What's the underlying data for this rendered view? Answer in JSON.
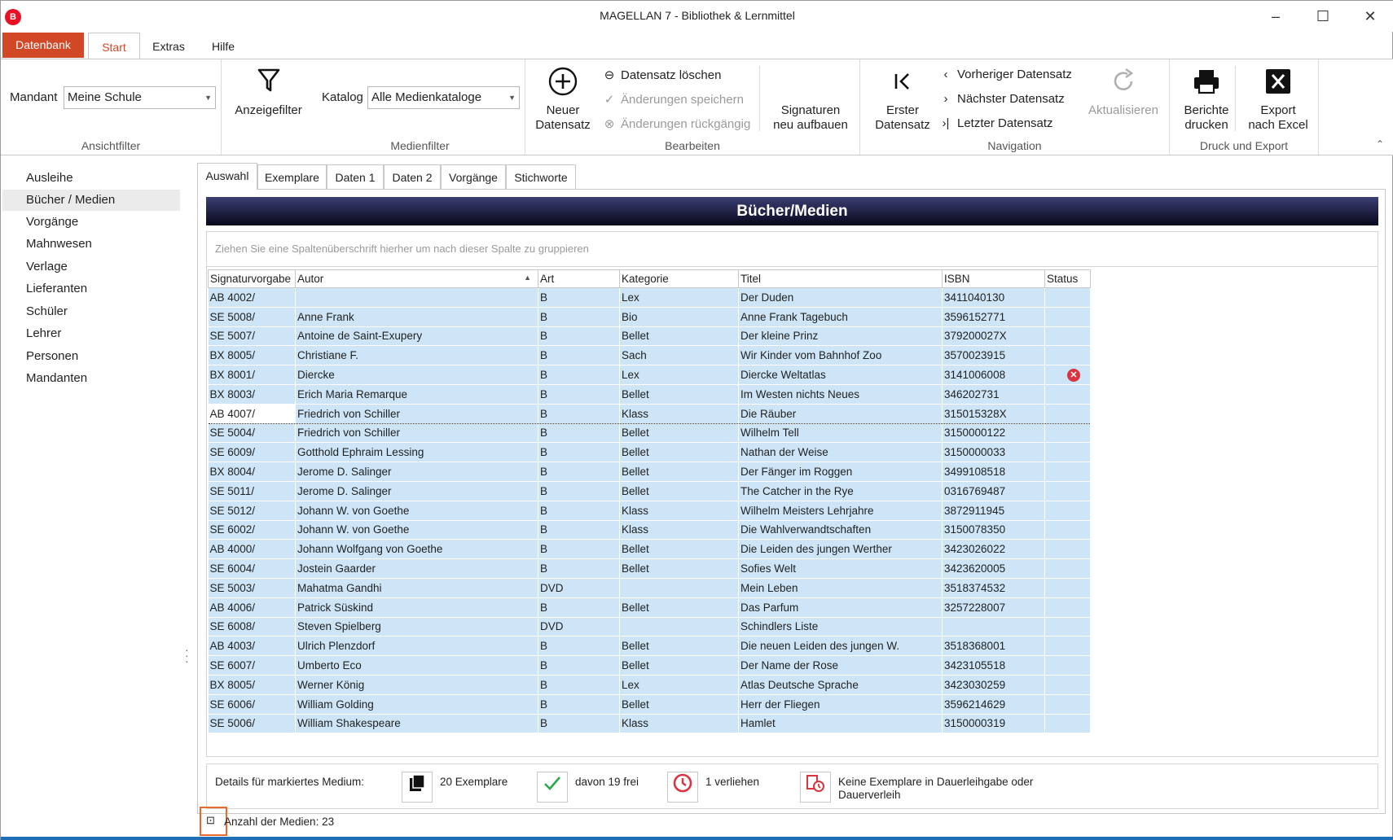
{
  "window": {
    "title": "MAGELLAN 7 - Bibliothek & Lernmittel",
    "badge": "B",
    "minimize": "–",
    "maximize": "☐",
    "close": "✕"
  },
  "ribbon_tabs": {
    "file": "Datenbank",
    "start": "Start",
    "extras": "Extras",
    "help": "Hilfe"
  },
  "ribbon": {
    "view_filter": {
      "mandant_label": "Mandant",
      "mandant_value": "Meine Schule",
      "group_label": "Ansichtfilter"
    },
    "display_filter": {
      "label": "Anzeigefilter"
    },
    "media_filter": {
      "katalog_label": "Katalog",
      "katalog_value": "Alle Medienkataloge",
      "group_label": "Medienfilter"
    },
    "edit": {
      "new_record_line1": "Neuer",
      "new_record_line2": "Datensatz",
      "delete_record": "Datensatz löschen",
      "save_changes": "Änderungen speichern",
      "undo_changes": "Änderungen rückgängig",
      "signatures_line1": "Signaturen",
      "signatures_line2": "neu aufbauen",
      "group_label": "Bearbeiten"
    },
    "navigation": {
      "first_line1": "Erster",
      "first_line2": "Datensatz",
      "previous": "Vorheriger Datensatz",
      "next": "Nächster Datensatz",
      "last": "Letzter Datensatz",
      "refresh": "Aktualisieren",
      "group_label": "Navigation"
    },
    "print_export": {
      "print_line1": "Berichte",
      "print_line2": "drucken",
      "excel_line1": "Export",
      "excel_line2": "nach Excel",
      "group_label": "Druck und Export"
    }
  },
  "sidebar": {
    "items": [
      {
        "label": "Ausleihe"
      },
      {
        "label": "Bücher / Medien"
      },
      {
        "label": "Vorgänge"
      },
      {
        "label": "Mahnwesen"
      },
      {
        "label": "Verlage"
      },
      {
        "label": "Lieferanten"
      },
      {
        "label": "Schüler"
      },
      {
        "label": "Lehrer"
      },
      {
        "label": "Personen"
      },
      {
        "label": "Mandanten"
      }
    ],
    "selected": "Bücher / Medien"
  },
  "content_tabs": [
    "Auswahl",
    "Exemplare",
    "Daten 1",
    "Daten 2",
    "Vorgänge",
    "Stichworte"
  ],
  "grid": {
    "title": "Bücher/Medien",
    "group_hint": "Ziehen Sie eine Spaltenüberschrift hierher um nach dieser Spalte zu gruppieren",
    "columns": [
      "Signaturvorgabe",
      "Autor",
      "Art",
      "Kategorie",
      "Titel",
      "ISBN",
      "Status"
    ],
    "sorted_column": "Autor",
    "rows": [
      [
        "AB 4002/",
        "",
        "B",
        "Lex",
        "Der Duden",
        "3411040130",
        ""
      ],
      [
        "SE 5008/",
        "Anne Frank",
        "B",
        "Bio",
        "Anne Frank Tagebuch",
        "3596152771",
        ""
      ],
      [
        "SE 5007/",
        "Antoine de Saint-Exupery",
        "B",
        "Bellet",
        "Der kleine Prinz",
        "379200027X",
        ""
      ],
      [
        "BX 8005/",
        "Christiane F.",
        "B",
        "Sach",
        "Wir Kinder vom Bahnhof Zoo",
        "3570023915",
        ""
      ],
      [
        "BX 8001/",
        "Diercke",
        "B",
        "Lex",
        "Diercke Weltatlas",
        "3141006008",
        "error"
      ],
      [
        "BX 8003/",
        "Erich Maria Remarque",
        "B",
        "Bellet",
        "Im Westen nichts Neues",
        "346202731",
        ""
      ],
      [
        "AB 4007/",
        "Friedrich von Schiller",
        "B",
        "Klass",
        "Die Räuber",
        "315015328X",
        ""
      ],
      [
        "SE 5004/",
        "Friedrich von Schiller",
        "B",
        "Bellet",
        "Wilhelm Tell",
        "3150000122",
        ""
      ],
      [
        "SE 6009/",
        "Gotthold Ephraim Lessing",
        "B",
        "Bellet",
        "Nathan der Weise",
        "3150000033",
        ""
      ],
      [
        "BX 8004/",
        "Jerome D. Salinger",
        "B",
        "Bellet",
        "Der Fänger im Roggen",
        "3499108518",
        ""
      ],
      [
        "SE 5011/",
        "Jerome D. Salinger",
        "B",
        "Bellet",
        "The Catcher in the Rye",
        "0316769487",
        ""
      ],
      [
        "SE 5012/",
        "Johann W. von Goethe",
        "B",
        "Klass",
        "Wilhelm Meisters Lehrjahre",
        "3872911945",
        ""
      ],
      [
        "SE 6002/",
        "Johann W. von Goethe",
        "B",
        "Klass",
        "Die Wahlverwandtschaften",
        "3150078350",
        ""
      ],
      [
        "AB 4000/",
        "Johann Wolfgang von Goethe",
        "B",
        "Bellet",
        "Die Leiden des jungen Werther",
        "3423026022",
        ""
      ],
      [
        "SE 6004/",
        "Jostein Gaarder",
        "B",
        "Bellet",
        "Sofies Welt",
        "3423620005",
        ""
      ],
      [
        "SE 5003/",
        "Mahatma Gandhi",
        "DVD",
        "",
        "Mein Leben",
        "3518374532",
        ""
      ],
      [
        "AB 4006/",
        "Patrick Süskind",
        "B",
        "Bellet",
        "Das Parfum",
        "3257228007",
        ""
      ],
      [
        "SE 6008/",
        "Steven Spielberg",
        "DVD",
        "",
        "Schindlers Liste",
        "",
        ""
      ],
      [
        "AB 4003/",
        "Ulrich Plenzdorf",
        "B",
        "Bellet",
        "Die neuen Leiden des jungen W.",
        "3518368001",
        ""
      ],
      [
        "SE 6007/",
        "Umberto Eco",
        "B",
        "Bellet",
        "Der Name der Rose",
        "3423105518",
        ""
      ],
      [
        "BX 8005/",
        "Werner König",
        "B",
        "Lex",
        "Atlas Deutsche Sprache",
        "3423030259",
        ""
      ],
      [
        "SE 6006/",
        "William Golding",
        "B",
        "Bellet",
        "Herr der Fliegen",
        "3596214629",
        ""
      ],
      [
        "SE 5006/",
        "William Shakespeare",
        "B",
        "Klass",
        "Hamlet",
        "3150000319",
        ""
      ]
    ],
    "focused_row": 6
  },
  "details": {
    "label": "Details für markiertes Medium:",
    "copies": "20 Exemplare",
    "free": "davon 19 frei",
    "lent": "1 verliehen",
    "permanent": "Keine Exemplare in Dauerleihgabe oder Dauerverleih"
  },
  "status": {
    "count_text": "Anzahl der Medien: 23"
  },
  "colors": {
    "accent": "#d24726",
    "row_bg": "#cde5f7",
    "header_dark": "#07071a",
    "status_highlight": "#e8692b"
  }
}
